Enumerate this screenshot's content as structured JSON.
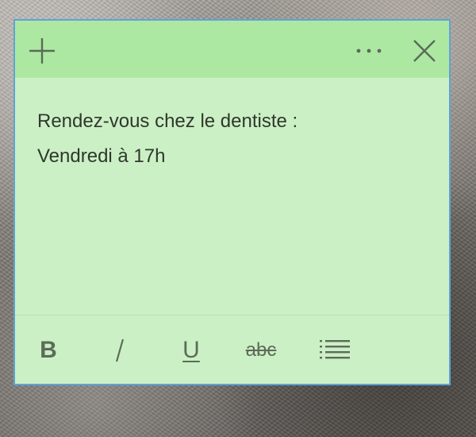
{
  "note": {
    "background_color": "#ccf0c5",
    "header_color": "#ade8a3",
    "border_color": "#5ea3d6",
    "lines": [
      "Rendez-vous chez le dentiste :",
      "Vendredi à 17h"
    ]
  },
  "header": {
    "add_icon": "plus-icon",
    "menu_icon": "ellipsis-icon",
    "menu_label": "···",
    "close_icon": "close-icon"
  },
  "toolbar": {
    "bold_label": "B",
    "italic_icon": "italic-icon",
    "underline_label": "U",
    "strikethrough_label": "abc",
    "list_icon": "bullet-list-icon"
  }
}
